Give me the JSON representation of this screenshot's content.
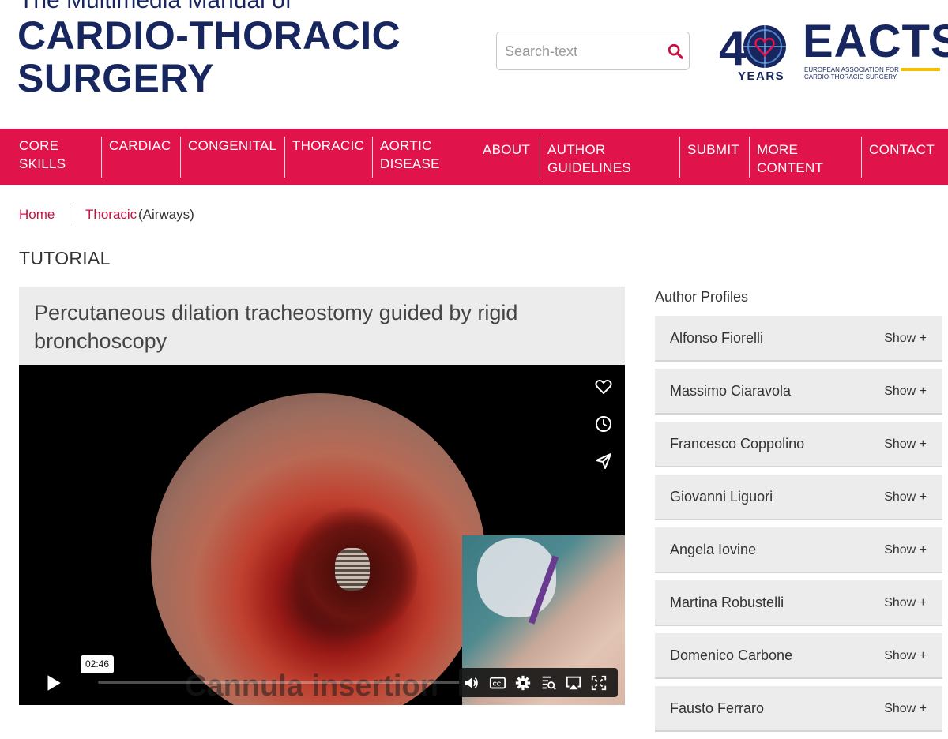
{
  "header": {
    "logo_line1": "The Multimedia Manual of",
    "logo_line2": "CARDIO-THORACIC",
    "logo_line3": "SURGERY",
    "search_placeholder": "Search-text",
    "eacts_years_number": "40",
    "eacts_years_label": "YEARS",
    "eacts_word": "EACTS",
    "eacts_sub1": "EUROPEAN ASSOCIATION FOR",
    "eacts_sub2": "CARDIO-THORACIC SURGERY"
  },
  "nav": {
    "items": [
      {
        "line1": "CORE",
        "line2": "SKILLS"
      },
      {
        "line1": "CARDIAC",
        "line2": ""
      },
      {
        "line1": "CONGENITAL",
        "line2": ""
      },
      {
        "line1": "THORACIC",
        "line2": ""
      },
      {
        "line1": "AORTIC",
        "line2": "DISEASE"
      },
      {
        "line1": "ABOUT",
        "line2": ""
      },
      {
        "line1": "AUTHOR",
        "line2": "GUIDELINES"
      },
      {
        "line1": "SUBMIT",
        "line2": ""
      },
      {
        "line1": "MORE",
        "line2": "CONTENT"
      },
      {
        "line1": "CONTACT",
        "line2": ""
      }
    ]
  },
  "breadcrumb": {
    "home": "Home",
    "section": "Thoracic",
    "subsection": "(Airways)"
  },
  "page": {
    "type_label": "TUTORIAL",
    "title": "Percutaneous dilation tracheostomy guided by rigid bronchoscopy"
  },
  "video": {
    "overlay_caption": "Cannula insertion",
    "hover_time": "02:46",
    "progress_fraction": 0.0,
    "side_icons": [
      "heart-icon",
      "clock-icon",
      "share-icon"
    ],
    "controls": [
      "volume-icon",
      "cc-icon",
      "settings-icon",
      "transcript-icon",
      "airplay-icon",
      "fullscreen-icon"
    ]
  },
  "sidebar": {
    "heading": "Author Profiles",
    "show_label": "Show +",
    "authors": [
      "Alfonso Fiorelli",
      "Massimo Ciaravola",
      "Francesco Coppolino",
      "Giovanni Liguori",
      "Angela Iovine",
      "Martina Robustelli",
      "Domenico Carbone",
      "Fausto Ferraro"
    ]
  },
  "colors": {
    "brand_navy": "#17265e",
    "nav_red": "#e0144a",
    "link_red": "#c8103e",
    "eacts_yellow": "#f5c000"
  }
}
